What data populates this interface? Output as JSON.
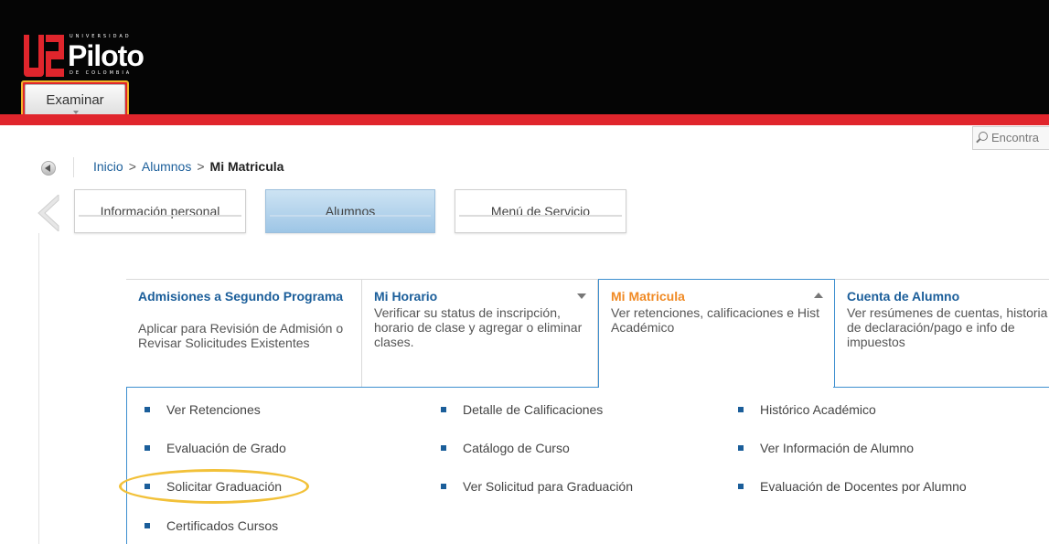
{
  "header": {
    "logo": {
      "mark": "U2",
      "top_text": "UNIVERSIDAD",
      "main_text": "Piloto",
      "bottom_text": "DE COLOMBIA"
    },
    "examinar_label": "Examinar",
    "search_placeholder": "Encontra",
    "colors": {
      "header_bg": "#050505",
      "brand_red": "#e0252c",
      "highlight_yellow": "#f2c139"
    }
  },
  "breadcrumb": {
    "items": [
      "Inicio",
      "Alumnos"
    ],
    "separator": ">",
    "current": "Mi Matricula"
  },
  "nav_tabs": [
    {
      "label": "Información personal",
      "active": false
    },
    {
      "label": "Alumnos",
      "active": true
    },
    {
      "label": "Menú de Servicio",
      "active": false
    }
  ],
  "cards": [
    {
      "title": "Admisiones a Segundo Programa",
      "description": "Aplicar para Revisión de Admisión o Revisar Solicitudes Existentes"
    },
    {
      "title": "Mi Horario",
      "description": "Verificar su status de inscripción, horario de clase y agregar o eliminar clases."
    },
    {
      "title": "Mi Matricula",
      "description": "Ver retenciones, calificaciones e Hist Académico",
      "expanded": true
    },
    {
      "title": "Cuenta de Alumno",
      "description": "Ver resúmenes de cuentas, historia de declaración/pago e info de impuestos"
    }
  ],
  "links": [
    "Ver Retenciones",
    "Detalle de Calificaciones",
    "Histórico Académico",
    "Evaluación de Grado",
    "Catálogo de Curso",
    "Ver Información de Alumno",
    "Solicitar Graduación",
    "Ver Solicitud para Graduación",
    "Evaluación de Docentes por Alumno",
    "Certificados Cursos"
  ],
  "highlighted_link": "Solicitar Graduación"
}
